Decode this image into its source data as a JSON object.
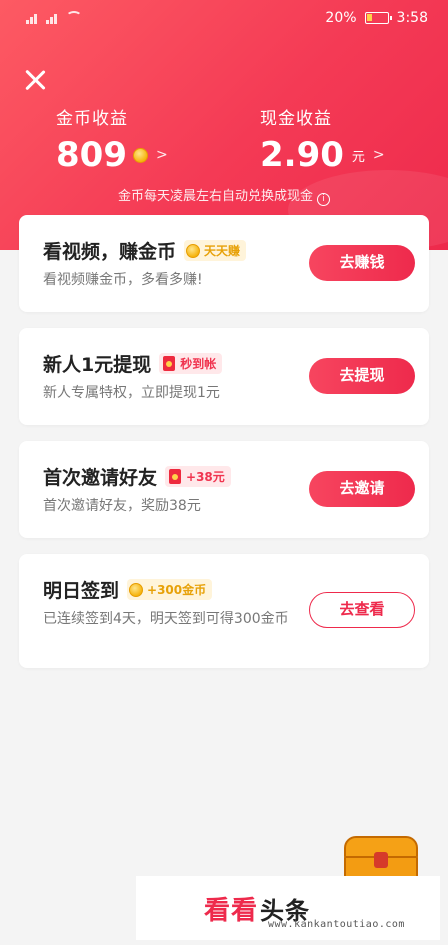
{
  "status_bar": {
    "battery": "20%",
    "time": "3:58"
  },
  "summary": {
    "coin_label": "金币收益",
    "coin_value": "809",
    "coin_chevron": ">",
    "cash_label": "现金收益",
    "cash_value": "2.90",
    "cash_unit": "元",
    "cash_chevron": ">",
    "note": "金币每天凌晨左右自动兑换成现金",
    "info_icon": "i"
  },
  "tasks": [
    {
      "title": "看视频，赚金币",
      "badge": "天天赚",
      "badge_icon": "coin-icon",
      "subtitle": "看视频赚金币，多看多赚!",
      "button": "去赚钱"
    },
    {
      "title": "新人1元提现",
      "badge": "秒到帐",
      "badge_icon": "red-envelope-icon",
      "subtitle": "新人专属特权，立即提现1元",
      "button": "去提现"
    },
    {
      "title": "首次邀请好友",
      "badge": "+38元",
      "badge_icon": "red-envelope-icon",
      "subtitle": "首次邀请好友，奖励38元",
      "button": "去邀请"
    },
    {
      "title": "明日签到",
      "badge": "+300金币",
      "badge_icon": "coin-icon",
      "subtitle": "已连续签到4天，明天签到可得300金币",
      "button": "去查看"
    }
  ],
  "watermark": {
    "brand_red": "看看",
    "brand_black": "头条",
    "url": "www.kankantoutiao.com"
  },
  "colors": {
    "accent": "#ee2a4c",
    "gold": "#e7a108",
    "background": "#f4f4f4"
  }
}
